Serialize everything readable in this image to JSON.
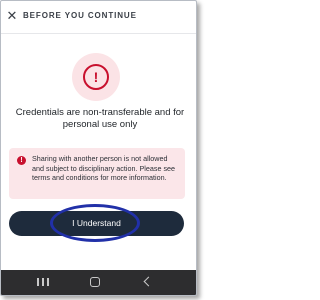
{
  "header": {
    "title": "BEFORE YOU CONTINUE",
    "close_icon": "close-icon"
  },
  "alert": {
    "icon": "alert-icon",
    "glyph": "!",
    "color": "#c8102e"
  },
  "headline": "Credentials are non-transferable and for personal use only",
  "notice": {
    "icon": "alert-small-icon",
    "glyph": "!",
    "text": "Sharing with another person is not allowed and subject to disciplinary action. Please see terms and conditions for more information."
  },
  "button": {
    "label": "I Understand",
    "color": "#1e2b3c"
  },
  "navbar": {
    "items": [
      "recents-icon",
      "home-icon",
      "back-icon"
    ]
  }
}
